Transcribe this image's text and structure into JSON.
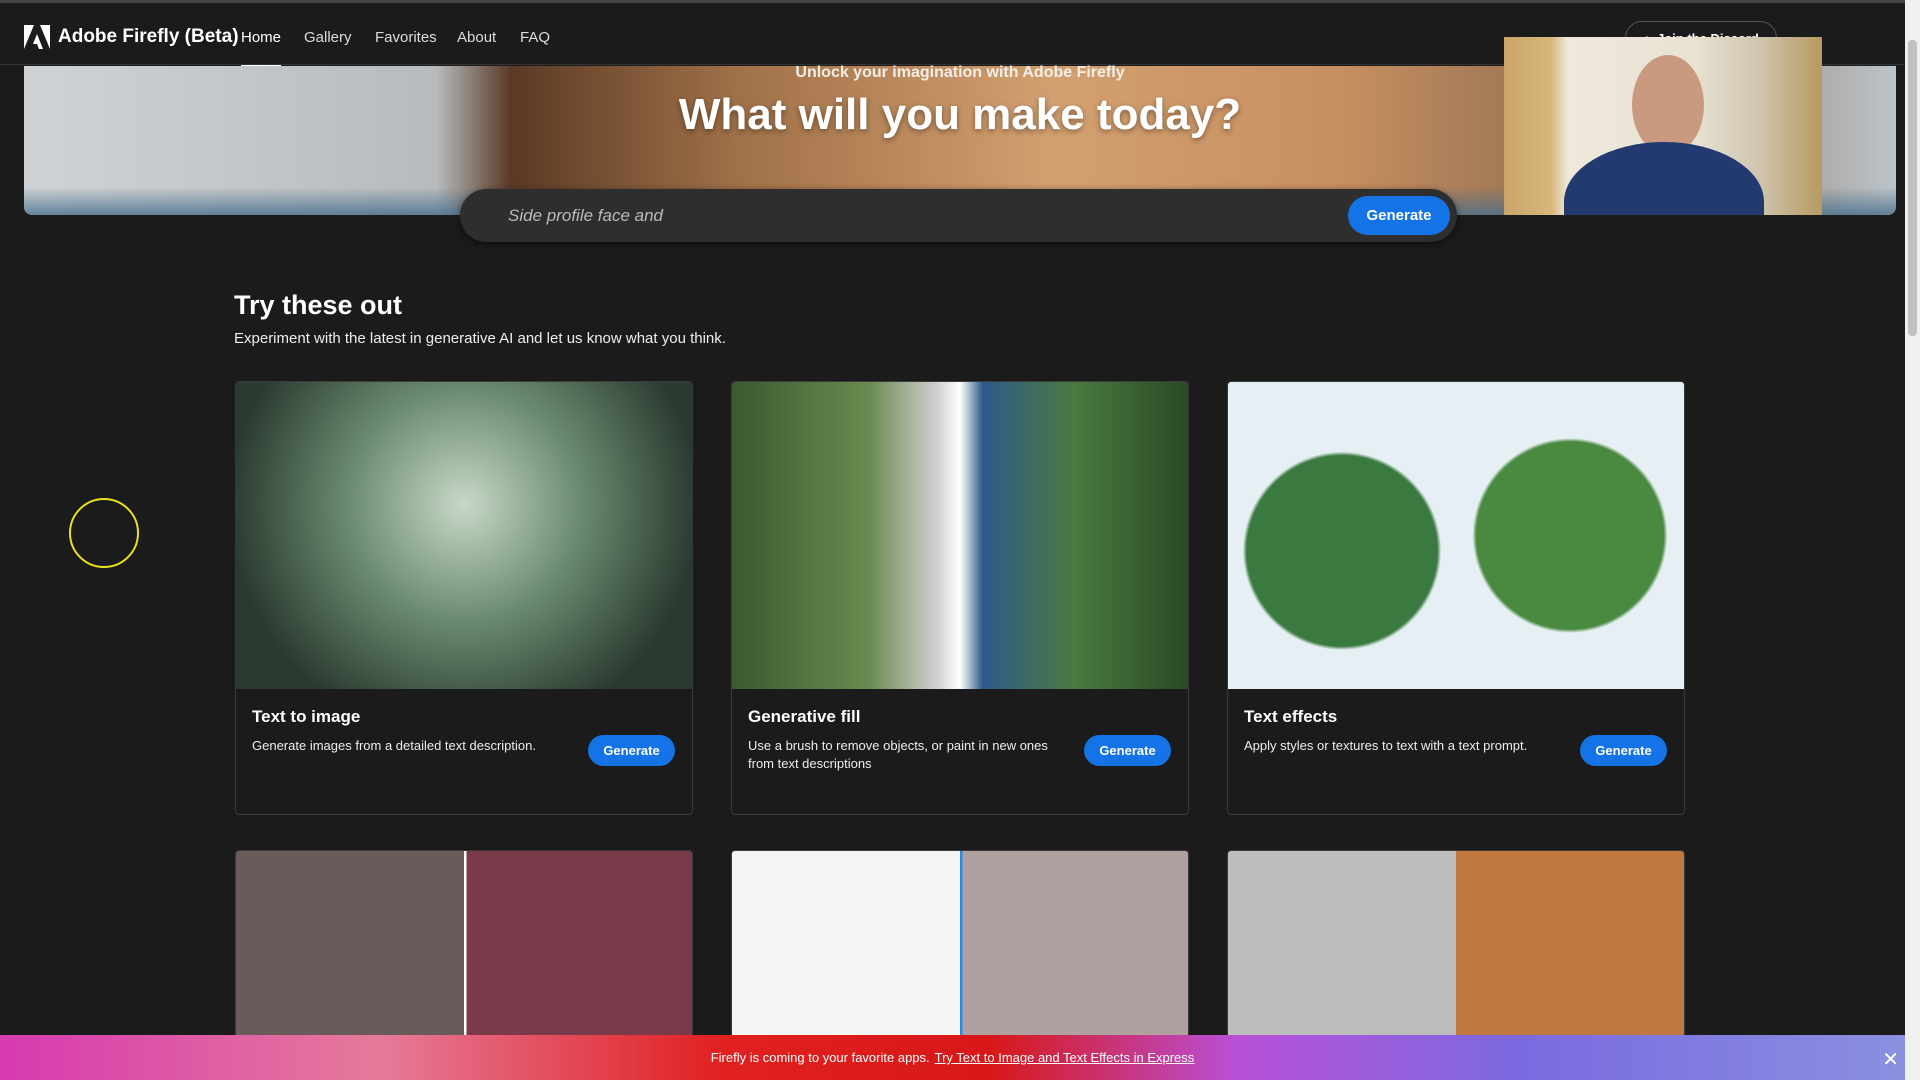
{
  "nav": {
    "brand": "Adobe Firefly (Beta)",
    "items": [
      "Home",
      "Gallery",
      "Favorites",
      "About",
      "FAQ"
    ],
    "active": "Home",
    "discord": "Join the Discord"
  },
  "hero": {
    "subtitle": "Unlock your imagination with Adobe Firefly",
    "title": "What will you make today?",
    "search_value": "Side profile face and",
    "generate": "Generate"
  },
  "section": {
    "title": "Try these out",
    "subtitle": "Experiment with the latest in generative AI and let us know what you think."
  },
  "cards": [
    {
      "title": "Text to image",
      "desc": "Generate images from a detailed text description.",
      "button": "Generate"
    },
    {
      "title": "Generative fill",
      "desc": "Use a brush to remove objects, or paint in new ones from text descriptions",
      "button": "Generate"
    },
    {
      "title": "Text effects",
      "desc": "Apply styles or textures to text with a text prompt.",
      "button": "Generate"
    }
  ],
  "banner": {
    "text": "Firefly is coming to your favorite apps.",
    "link": "Try Text to Image and Text Effects in Express",
    "close": "✕"
  },
  "colors": {
    "accent": "#1473e6",
    "background": "#1b1b1b"
  }
}
